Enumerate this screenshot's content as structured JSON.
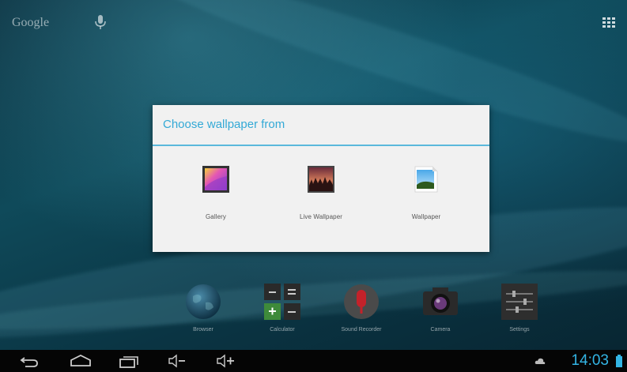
{
  "top_bar": {
    "search_label": "Google",
    "mic_icon": "microphone-icon",
    "apps_icon": "all-apps-grid-icon"
  },
  "dialog": {
    "title": "Choose wallpaper from",
    "options": [
      {
        "label": "Gallery",
        "icon": "gallery-icon"
      },
      {
        "label": "Live Wallpaper",
        "icon": "live-wallpaper-icon"
      },
      {
        "label": "Wallpaper",
        "icon": "wallpaper-icon"
      }
    ],
    "accent_color": "#33a9d6"
  },
  "dock": [
    {
      "label": "Browser",
      "icon": "globe-icon"
    },
    {
      "label": "Calculator",
      "icon": "calculator-icon"
    },
    {
      "label": "Sound Recorder",
      "icon": "sound-recorder-icon"
    },
    {
      "label": "Camera",
      "icon": "camera-icon"
    },
    {
      "label": "Settings",
      "icon": "settings-icon"
    }
  ],
  "nav_bar": {
    "buttons": [
      "back-icon",
      "home-icon",
      "recent-apps-icon",
      "volume-down-icon",
      "volume-up-icon"
    ],
    "clock": "14:03",
    "clock_color": "#33b5e5"
  }
}
